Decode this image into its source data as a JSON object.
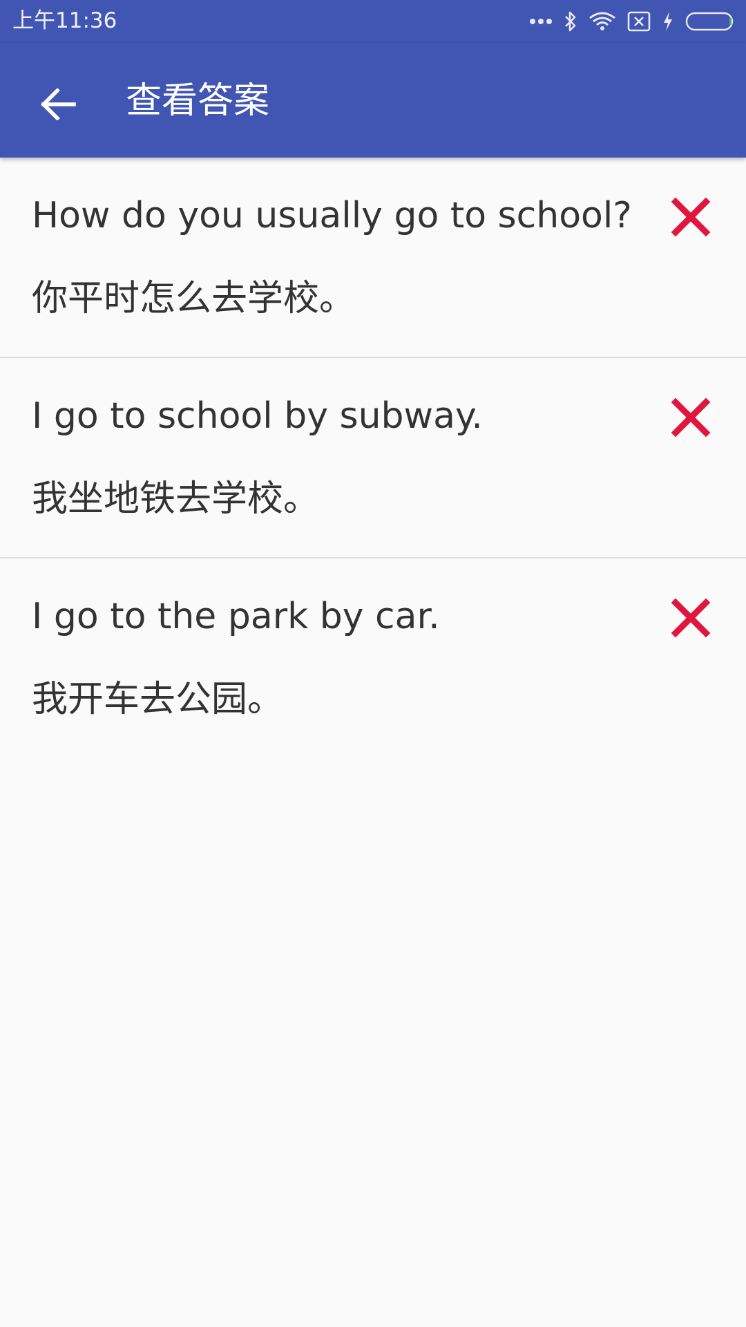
{
  "status_bar": {
    "time": "上午11:36",
    "icons": [
      "more-dots-icon",
      "bluetooth-icon",
      "wifi-icon",
      "sim-blocked-icon",
      "charging-icon",
      "battery-icon"
    ]
  },
  "app_bar": {
    "title": "查看答案",
    "back_icon": "arrow-back-icon",
    "color": "#4156b2"
  },
  "answers": [
    {
      "english": "How do you usually go to school?",
      "chinese": "你平时怎么去学校。",
      "result_icon": "wrong-x-icon"
    },
    {
      "english": "I go to school by subway.",
      "chinese": "我坐地铁去学校。",
      "result_icon": "wrong-x-icon"
    },
    {
      "english": "I go to the park by car.",
      "chinese": "我开车去公园。",
      "result_icon": "wrong-x-icon"
    }
  ],
  "colors": {
    "wrong": "#e0163e",
    "text": "#333333",
    "background": "#fafafa"
  }
}
